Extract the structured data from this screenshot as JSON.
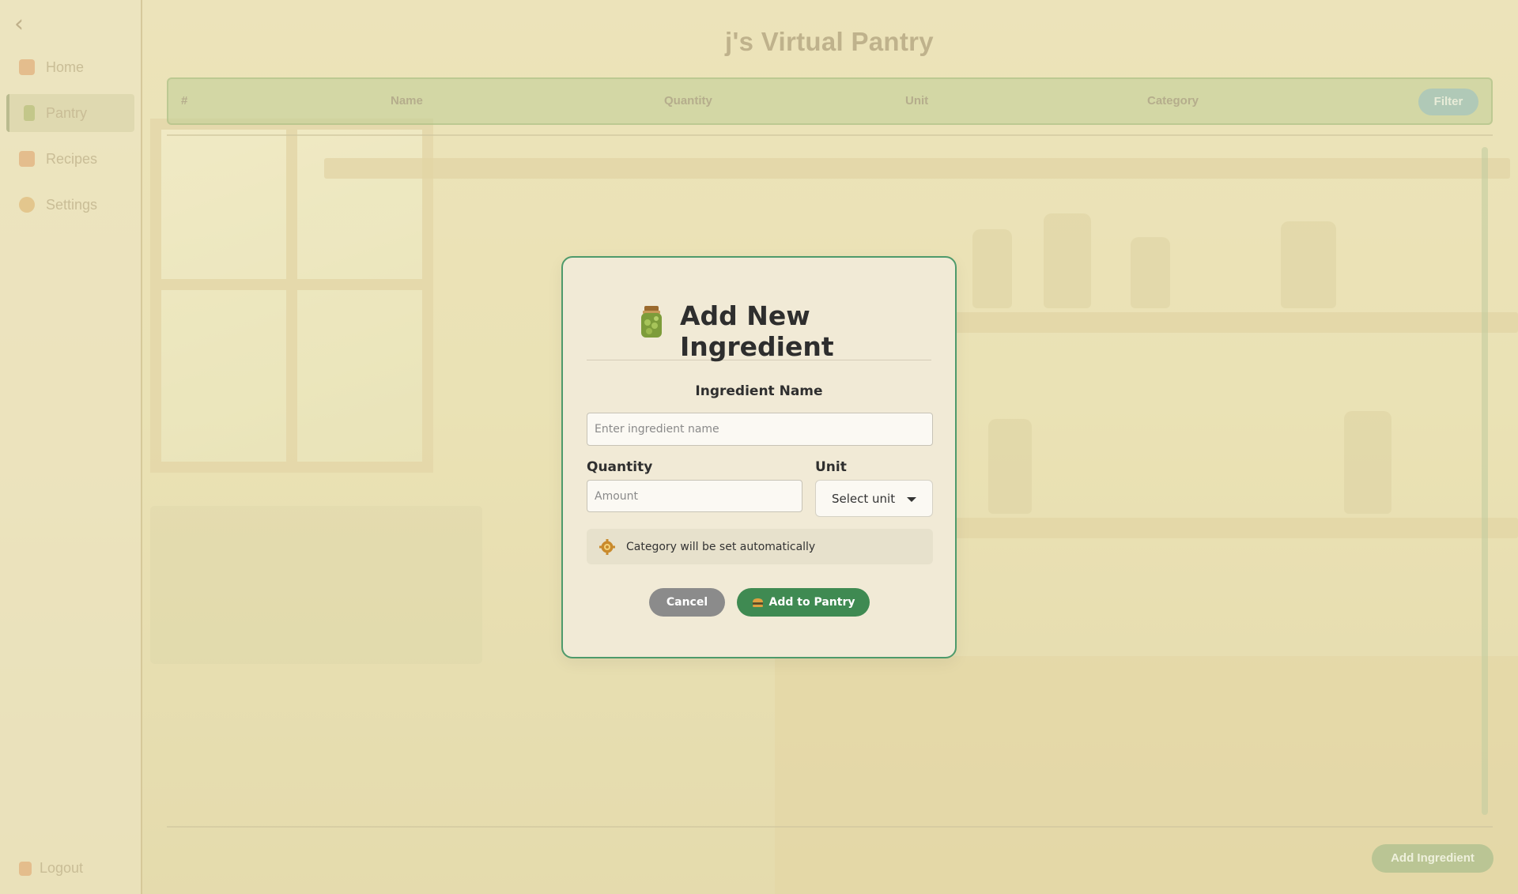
{
  "app": {
    "title": "j's Virtual Pantry"
  },
  "sidebar": {
    "back_icon": "chevron-left-icon",
    "items": [
      {
        "label": "Home",
        "icon": "home-icon",
        "color": "#d9a36a",
        "active": false
      },
      {
        "label": "Pantry",
        "icon": "jar-icon",
        "color": "#a6b36a",
        "active": true
      },
      {
        "label": "Recipes",
        "icon": "recipe-book-icon",
        "color": "#d9a36a",
        "active": false
      },
      {
        "label": "Settings",
        "icon": "gear-icon",
        "color": "#d9b26a",
        "active": false
      }
    ],
    "logout": {
      "label": "Logout",
      "icon": "logout-icon"
    }
  },
  "table": {
    "columns": [
      "#",
      "Name",
      "Quantity",
      "Unit",
      "Category"
    ],
    "filter_label": "Filter"
  },
  "footer": {
    "add_ingredient_label": "Add Ingredient"
  },
  "modal": {
    "title": "Add New Ingredient",
    "title_icon": "jar-icon",
    "name_label": "Ingredient Name",
    "name_placeholder": "Enter ingredient name",
    "name_value": "",
    "quantity_label": "Quantity",
    "quantity_placeholder": "Amount",
    "quantity_value": "",
    "unit_label": "Unit",
    "unit_selected": "Select unit",
    "category_note": "Category will be set automatically",
    "category_note_icon": "gear-icon",
    "cancel_label": "Cancel",
    "submit_label": "Add to Pantry",
    "submit_icon": "burger-icon"
  },
  "colors": {
    "accent": "#3f8a52",
    "modal_border": "#4e9a6b",
    "modal_bg": "#f1ead6",
    "cancel": "#8b8b8b"
  }
}
